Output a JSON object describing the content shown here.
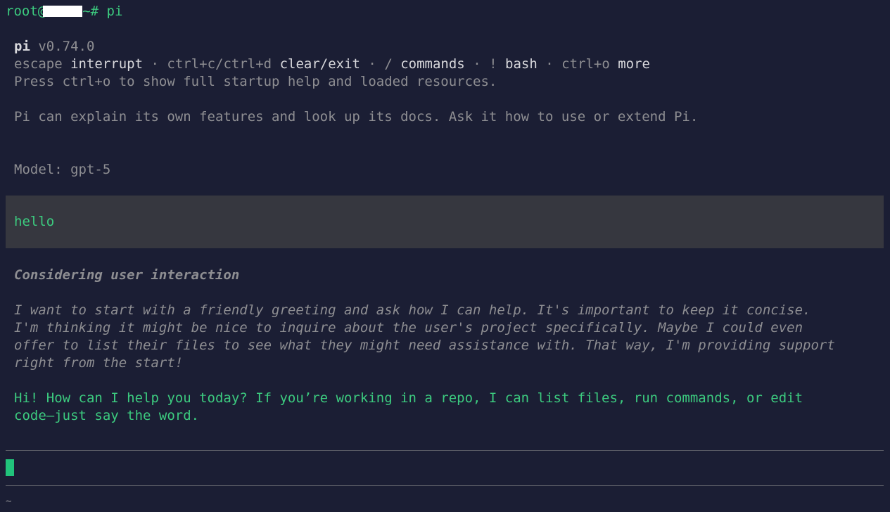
{
  "shell": {
    "user": "root@",
    "prompt_suffix": "~# ",
    "command": "pi"
  },
  "header": {
    "name": "pi",
    "version": "v0.74.0"
  },
  "shortcuts": [
    {
      "key": "escape",
      "action": "interrupt"
    },
    {
      "key": "ctrl+c/ctrl+d",
      "action": "clear/exit"
    },
    {
      "key": "/",
      "action": "commands"
    },
    {
      "key": "!",
      "action": "bash"
    },
    {
      "key": "ctrl+o",
      "action": "more"
    }
  ],
  "separator": "·",
  "startup_hint": "Press ctrl+o to show full startup help and loaded resources.",
  "info": "Pi can explain its own features and look up its docs. Ask it how to use or extend Pi.",
  "model_line": "Model: gpt-5",
  "user_message": "hello",
  "thinking": {
    "title": "Considering user interaction",
    "lines": [
      "I want to start with a friendly greeting and ask how I can help. It's important to keep it concise.",
      "I'm thinking it might be nice to inquire about the user's project specifically. Maybe I could even",
      "offer to list their files to see what they might need assistance with. That way, I'm providing support",
      "right from the start!"
    ]
  },
  "response": {
    "lines": [
      "Hi! How can I help you today? If you’re working in a repo, I can list files, run commands, or edit",
      "code—just say the word."
    ]
  },
  "footer": {
    "tilde": "~"
  },
  "colors": {
    "background": "#1b1e34",
    "accent_green": "#3ccb7f",
    "dim_text": "#8e8e92",
    "bright_text": "#d8d8dc",
    "user_box": "#36373f"
  }
}
